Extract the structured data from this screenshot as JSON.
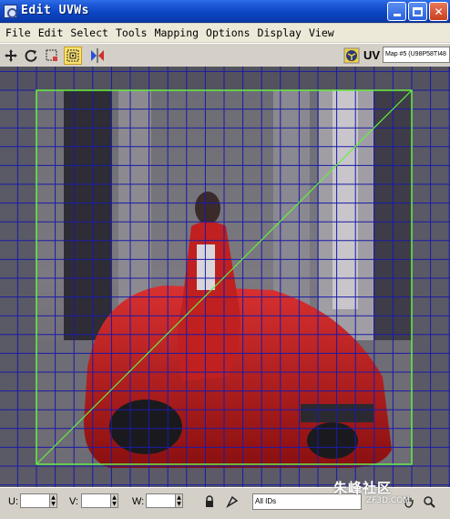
{
  "window": {
    "title": "Edit UVWs",
    "minimize_icon": "minimize-icon",
    "maximize_icon": "maximize-icon",
    "close_label": "✕"
  },
  "menu": {
    "items": [
      "File",
      "Edit",
      "Select",
      "Tools",
      "Mapping",
      "Options",
      "Display",
      "View"
    ]
  },
  "toolbar": {
    "tools": [
      "move-icon",
      "rotate-icon",
      "scale-icon",
      "freeform-icon",
      "mirror-icon"
    ],
    "active_tool": "freeform-icon",
    "uv_label": "UV",
    "texture_map": "Map #5 (U98P58TI48"
  },
  "bottombar": {
    "u_label": "U:",
    "v_label": "V:",
    "w_label": "W:",
    "u_value": "",
    "v_value": "",
    "w_value": "",
    "id_filter": "All IDs"
  },
  "watermark": {
    "text": "朱峰社区",
    "sub": "ZF3D.COM"
  },
  "colors": {
    "grid": "#1a1aa8",
    "uv_border": "#66ee44",
    "diagonal": "#66ee44"
  }
}
